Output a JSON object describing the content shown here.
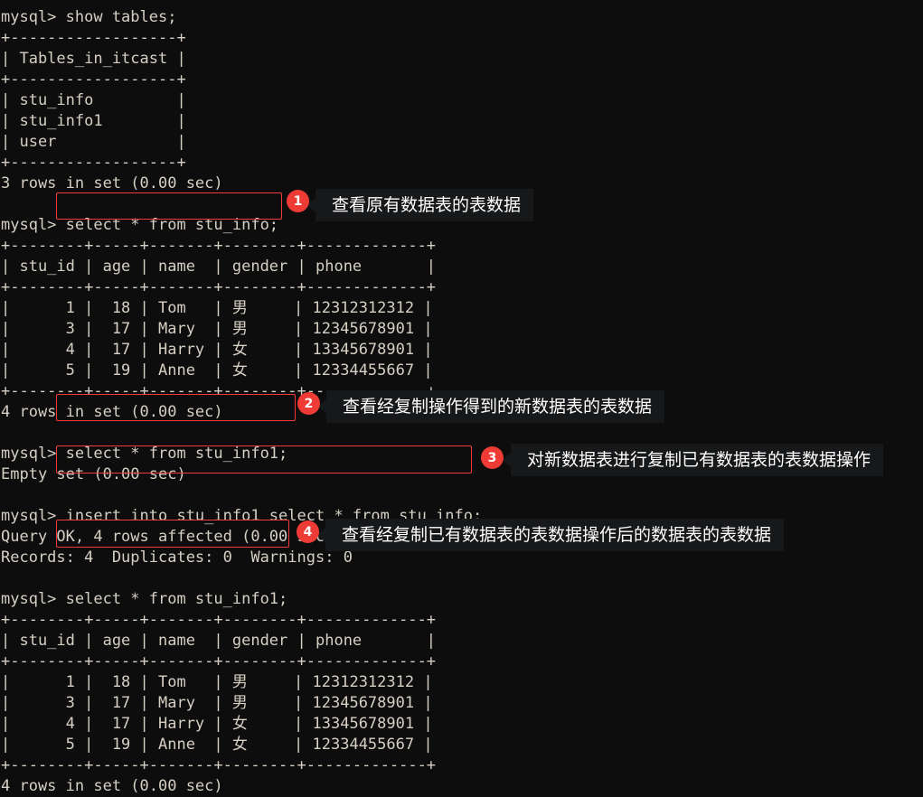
{
  "terminal": {
    "prompt": "mysql> ",
    "lines": [
      "mysql> show tables;",
      "+------------------+",
      "| Tables_in_itcast |",
      "+------------------+",
      "| stu_info         |",
      "| stu_info1        |",
      "| user             |",
      "+------------------+",
      "3 rows in set (0.00 sec)",
      "",
      "mysql> select * from stu_info;",
      "+--------+-----+-------+--------+-------------+",
      "| stu_id | age | name  | gender | phone       |",
      "+--------+-----+-------+--------+-------------+",
      "|      1 |  18 | Tom   | 男     | 12312312312 |",
      "|      3 |  17 | Mary  | 男     | 12345678901 |",
      "|      4 |  17 | Harry | 女     | 13345678901 |",
      "|      5 |  19 | Anne  | 女     | 12334455667 |",
      "+--------+-----+-------+--------+-------------+",
      "4 rows in set (0.00 sec)",
      "",
      "mysql> select * from stu_info1;",
      "Empty set (0.00 sec)",
      "",
      "mysql> insert into stu_info1 select * from stu_info;",
      "Query OK, 4 rows affected (0.00 sec)",
      "Records: 4  Duplicates: 0  Warnings: 0",
      "",
      "mysql> select * from stu_info1;",
      "+--------+-----+-------+--------+-------------+",
      "| stu_id | age | name  | gender | phone       |",
      "+--------+-----+-------+--------+-------------+",
      "|      1 |  18 | Tom   | 男     | 12312312312 |",
      "|      3 |  17 | Mary  | 男     | 12345678901 |",
      "|      4 |  17 | Harry | 女     | 13345678901 |",
      "|      5 |  19 | Anne  | 女     | 12334455667 |",
      "+--------+-----+-------+--------+-------------+",
      "4 rows in set (0.00 sec)"
    ],
    "commands": [
      "show tables;",
      "select * from stu_info;",
      "select * from stu_info1;",
      "insert into stu_info1 select * from stu_info;",
      "select * from stu_info1;"
    ],
    "tables_result": {
      "header": "Tables_in_itcast",
      "rows": [
        "stu_info",
        "stu_info1",
        "user"
      ],
      "footer": "3 rows in set (0.00 sec)"
    },
    "stu_info_result": {
      "columns": [
        "stu_id",
        "age",
        "name",
        "gender",
        "phone"
      ],
      "rows": [
        [
          "1",
          "18",
          "Tom",
          "男",
          "12312312312"
        ],
        [
          "3",
          "17",
          "Mary",
          "男",
          "12345678901"
        ],
        [
          "4",
          "17",
          "Harry",
          "女",
          "13345678901"
        ],
        [
          "5",
          "19",
          "Anne",
          "女",
          "12334455667"
        ]
      ],
      "footer": "4 rows in set (0.00 sec)"
    },
    "empty_result": "Empty set (0.00 sec)",
    "insert_result": {
      "line1": "Query OK, 4 rows affected (0.00 sec)",
      "line2": "Records: 4  Duplicates: 0  Warnings: 0"
    }
  },
  "annotations": [
    {
      "number": "1",
      "text": "查看原有数据表的表数据"
    },
    {
      "number": "2",
      "text": "查看经复制操作得到的新数据表的表数据"
    },
    {
      "number": "3",
      "text": "对新数据表进行复制已有数据表的表数据操作"
    },
    {
      "number": "4",
      "text": "查看经复制已有数据表的表数据操作后的数据表的表数据"
    }
  ],
  "colors": {
    "terminal_background": "#0d0d0d",
    "terminal_text": "#d6cfc4",
    "badge_red": "#ef3b35",
    "highlight_border": "#f23b3b",
    "note_background": "#17181a",
    "note_text": "#ffffff"
  }
}
